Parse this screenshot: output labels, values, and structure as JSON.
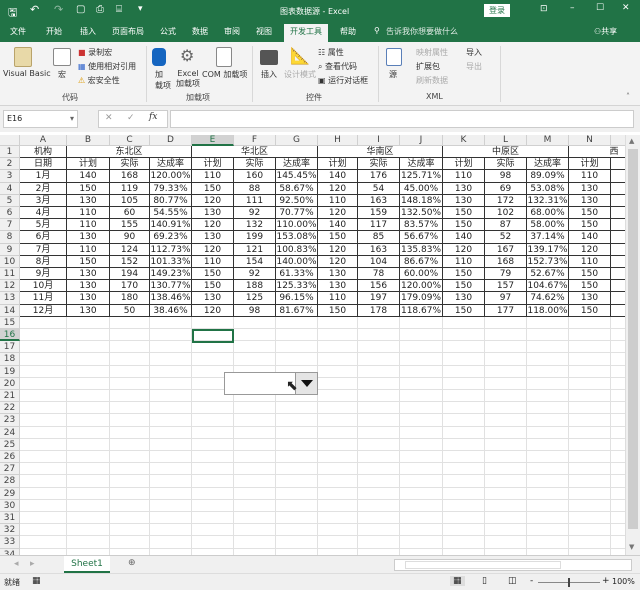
{
  "window": {
    "title": "图表数据源 - Excel",
    "login": "登录",
    "share": "共享"
  },
  "qat": {
    "save": "save-icon",
    "undo": "undo-icon",
    "redo": "redo-icon"
  },
  "tabs": [
    "文件",
    "开始",
    "插入",
    "页面布局",
    "公式",
    "数据",
    "审阅",
    "视图",
    "开发工具",
    "帮助"
  ],
  "active_tab": "开发工具",
  "tell_me": "告诉我你想要做什么",
  "ribbon": {
    "code": {
      "label": "代码",
      "vb": "Visual Basic",
      "macro": "宏",
      "record": "录制宏",
      "relative": "使用相对引用",
      "security": "宏安全性"
    },
    "addins": {
      "label": "加载项",
      "addin1": "加",
      "addin2": "载项",
      "excel1": "Excel",
      "excel2": "加载项",
      "com": "COM 加载项"
    },
    "controls": {
      "label": "控件",
      "insert": "插入",
      "design": "设计模式",
      "props": "属性",
      "code": "查看代码",
      "dialog": "运行对话框"
    },
    "xml": {
      "label": "XML",
      "source": "源",
      "map": "映射属性",
      "expand": "扩展包",
      "refresh": "刷新数据",
      "import": "导入",
      "export": "导出"
    }
  },
  "formula_bar": {
    "name_box": "E16",
    "fx": "fx",
    "value": ""
  },
  "columns": [
    "A",
    "B",
    "C",
    "D",
    "E",
    "F",
    "G",
    "H",
    "I",
    "J",
    "K",
    "L",
    "M",
    "N",
    "O"
  ],
  "selected_column": "E",
  "selected_row": 16,
  "table": {
    "row1": {
      "A": "机构",
      "regions": [
        "东北区",
        "华北区",
        "华南区",
        "中原区",
        "西"
      ]
    },
    "row2": [
      "日期",
      "计划",
      "实际",
      "达成率",
      "计划",
      "实际",
      "达成率",
      "计划",
      "实际",
      "达成率",
      "计划",
      "实际",
      "达成率",
      "计划",
      ""
    ],
    "rows": [
      [
        "1月",
        "140",
        "168",
        "120.00%",
        "110",
        "160",
        "145.45%",
        "140",
        "176",
        "125.71%",
        "110",
        "98",
        "89.09%",
        "110"
      ],
      [
        "2月",
        "150",
        "119",
        "79.33%",
        "150",
        "88",
        "58.67%",
        "120",
        "54",
        "45.00%",
        "130",
        "69",
        "53.08%",
        "130"
      ],
      [
        "3月",
        "130",
        "105",
        "80.77%",
        "120",
        "111",
        "92.50%",
        "110",
        "163",
        "148.18%",
        "130",
        "172",
        "132.31%",
        "130"
      ],
      [
        "4月",
        "110",
        "60",
        "54.55%",
        "130",
        "92",
        "70.77%",
        "120",
        "159",
        "132.50%",
        "150",
        "102",
        "68.00%",
        "150"
      ],
      [
        "5月",
        "110",
        "155",
        "140.91%",
        "120",
        "132",
        "110.00%",
        "140",
        "117",
        "83.57%",
        "150",
        "87",
        "58.00%",
        "150"
      ],
      [
        "6月",
        "130",
        "90",
        "69.23%",
        "130",
        "199",
        "153.08%",
        "150",
        "85",
        "56.67%",
        "140",
        "52",
        "37.14%",
        "140"
      ],
      [
        "7月",
        "110",
        "124",
        "112.73%",
        "120",
        "121",
        "100.83%",
        "120",
        "163",
        "135.83%",
        "120",
        "167",
        "139.17%",
        "120"
      ],
      [
        "8月",
        "150",
        "152",
        "101.33%",
        "110",
        "154",
        "140.00%",
        "120",
        "104",
        "86.67%",
        "110",
        "168",
        "152.73%",
        "110"
      ],
      [
        "9月",
        "130",
        "194",
        "149.23%",
        "150",
        "92",
        "61.33%",
        "130",
        "78",
        "60.00%",
        "150",
        "79",
        "52.67%",
        "150"
      ],
      [
        "10月",
        "130",
        "170",
        "130.77%",
        "150",
        "188",
        "125.33%",
        "130",
        "156",
        "120.00%",
        "150",
        "157",
        "104.67%",
        "150"
      ],
      [
        "11月",
        "130",
        "180",
        "138.46%",
        "130",
        "125",
        "96.15%",
        "110",
        "197",
        "179.09%",
        "130",
        "97",
        "74.62%",
        "130"
      ],
      [
        "12月",
        "130",
        "50",
        "38.46%",
        "120",
        "98",
        "81.67%",
        "150",
        "178",
        "118.67%",
        "150",
        "177",
        "118.00%",
        "150"
      ]
    ]
  },
  "row_count": 36,
  "sheets": [
    "Sheet1"
  ],
  "status": {
    "ready": "就绪",
    "zoom": "100%",
    "zoom_percent": 100
  },
  "colors": {
    "accent": "#217346"
  }
}
